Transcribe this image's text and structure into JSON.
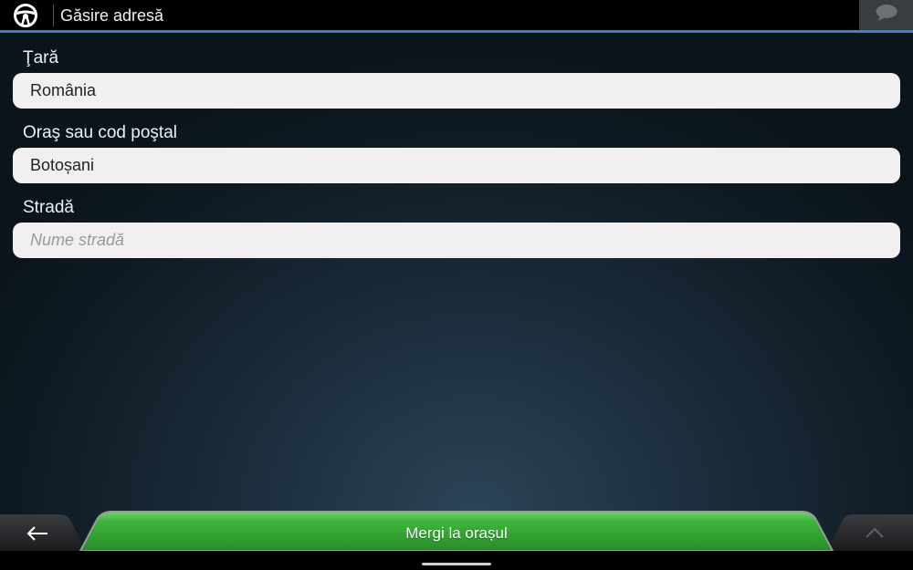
{
  "header": {
    "title": "Găsire adresă",
    "logo_icon": "steering-wheel-icon",
    "message_icon": "speech-bubble-icon"
  },
  "form": {
    "country": {
      "label": "Ţară",
      "value": "România"
    },
    "city": {
      "label": "Oraş sau cod poştal",
      "value": "Botoșani"
    },
    "street": {
      "label": "Stradă",
      "value": "",
      "placeholder": "Nume stradă"
    }
  },
  "footer": {
    "back_icon": "arrow-left-icon",
    "primary_label": "Mergi la orașul",
    "up_icon": "chevron-up-icon"
  },
  "colors": {
    "accent": "#3a7fd0",
    "primary_green": "#3aa63a"
  }
}
